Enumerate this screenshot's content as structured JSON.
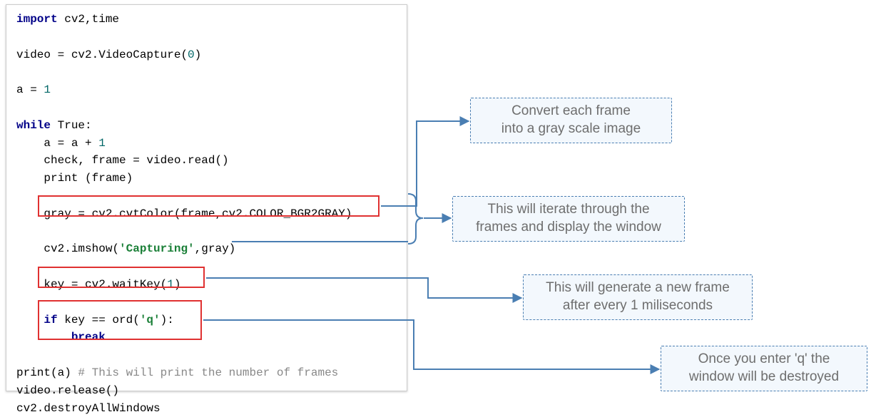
{
  "code": {
    "l1a": "import",
    "l1b": " cv2,time",
    "l3": "video = cv2.VideoCapture(",
    "l3n": "0",
    "l3c": ")",
    "l5a": "a = ",
    "l5n": "1",
    "l7a": "while",
    "l7b": " True:",
    "l8a": "    a = a + ",
    "l8n": "1",
    "l9": "    check, frame = video.read()",
    "l10": "    print (frame)",
    "l12a": "    gray = cv2.cvtColor(frame,cv2.COLOR_BGR2GRAY)",
    "l14a": "    cv2.imshow(",
    "l14s": "'Capturing'",
    "l14b": ",gray)",
    "l16a": "    key = cv2.waitKey(",
    "l16n": "1",
    "l16b": ")",
    "l18a": "    ",
    "l18if": "if",
    "l18b": " key == ord(",
    "l18s": "'q'",
    "l18c": "):",
    "l19a": "        ",
    "l19b": "break",
    "l21a": "print(a) ",
    "l21c": "# This will print the number of frames",
    "l22": "video.release()",
    "l23": "cv2.destroyAllWindows"
  },
  "callouts": {
    "c1": "Convert each frame\ninto a gray scale image",
    "c2": "This will iterate through the\nframes and display the window",
    "c3": "This will generate a new frame\nafter every 1 miliseconds",
    "c4": "Once you enter 'q' the\nwindow will be destroyed"
  },
  "boxes": {
    "gray": "code-box-gray",
    "waitkey": "code-box-waitkey",
    "quit": "code-box-quit"
  },
  "colors": {
    "highlight_border": "#e03131",
    "callout_border": "#4a7eb2",
    "callout_bg": "#f3f8fd",
    "arrow": "#4a7eb2"
  }
}
